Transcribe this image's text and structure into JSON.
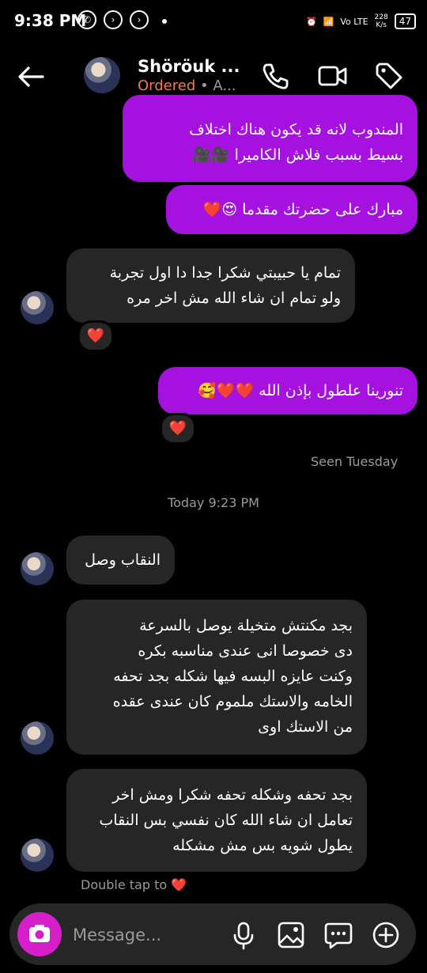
{
  "status_bar": {
    "time": "9:38 PM",
    "net_speed": "228\nK/s",
    "network": "Vo LTE",
    "battery": "47"
  },
  "header": {
    "contact_name": "Shöröuk ...",
    "status": "Ordered",
    "status_rest": "• A..."
  },
  "messages": [
    {
      "side": "sent",
      "text": "المندوب لانه قد يكون هناك اختلاف\nبسيط بسبب فلاش الكاميرا 🎥🎥"
    },
    {
      "side": "sent",
      "text": "مبارك على حضرتك مقدما 😍❤️"
    },
    {
      "side": "received",
      "text": "تمام يا حبيبتي شكرا جدا دا اول تجربة\nولو تمام ان شاء الله مش اخر مره",
      "reaction": "❤️"
    },
    {
      "side": "sent",
      "text": "تنورينا علطول بإذن الله ❤️❤️🥰",
      "reaction": "❤️"
    },
    {
      "side": "received",
      "text": "النقاب وصل"
    },
    {
      "side": "received",
      "text": "بجد مكنتش متخيلة يوصل بالسرعة\nدى خصوصا انى عندى مناسبه بكره\nوكنت عايزه البسه فيها  شكله بجد تحفه\nالخامه والاستك ملموم  كان عندى عقده\nمن الاستك اوى"
    },
    {
      "side": "received",
      "text": "بجد تحفه وشكله تحفه  شكرا ومش اخر\nتعامل ان شاء الله  كان نفسي بس النقاب\nيطول شويه بس مش مشكله"
    }
  ],
  "seen_label": "Seen Tuesday",
  "date_divider": "Today 9:23 PM",
  "double_tap_hint": "Double tap to ❤️",
  "composer": {
    "placeholder": "Message..."
  },
  "icons": {
    "back": "arrow-left-icon",
    "call": "phone-icon",
    "video": "video-camera-icon",
    "tag": "tag-icon",
    "camera": "camera-icon",
    "mic": "microphone-icon",
    "gallery": "image-icon",
    "sticker": "chat-dots-icon",
    "plus": "plus-circle-icon"
  },
  "colors": {
    "sent_bubble": "#a512e0",
    "received_bubble": "#262626",
    "status_accent": "#f5784b",
    "camera_button": "#d61fcb"
  }
}
